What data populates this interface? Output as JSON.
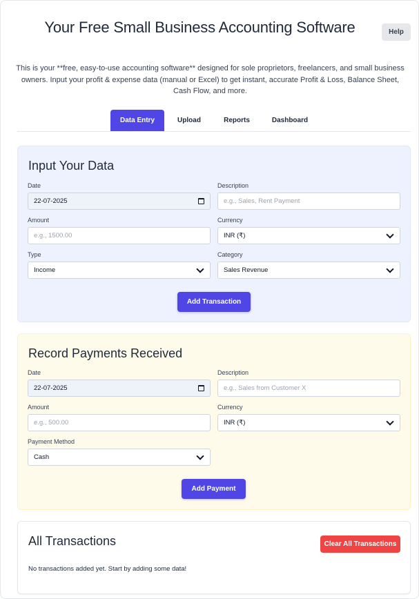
{
  "header": {
    "title": "Your Free Small Business Accounting Software",
    "help_label": "Help",
    "intro": "This is your **free, easy-to-use accounting software** designed for sole proprietors, freelancers, and small business owners. Input your profit & expense data (manual or Excel) to get instant, accurate Profit & Loss, Balance Sheet, Cash Flow, and more."
  },
  "tabs": [
    {
      "label": "Data Entry",
      "active": true
    },
    {
      "label": "Upload",
      "active": false
    },
    {
      "label": "Reports",
      "active": false
    },
    {
      "label": "Dashboard",
      "active": false
    }
  ],
  "input_data": {
    "title": "Input Your Data",
    "date": {
      "label": "Date",
      "value": "22-07-2025"
    },
    "description": {
      "label": "Description",
      "placeholder": "e.g., Sales, Rent Payment"
    },
    "amount": {
      "label": "Amount",
      "placeholder": "e.g., 1500.00"
    },
    "currency": {
      "label": "Currency",
      "value": "INR (₹)"
    },
    "type": {
      "label": "Type",
      "value": "Income"
    },
    "category": {
      "label": "Category",
      "value": "Sales Revenue"
    },
    "submit_label": "Add Transaction"
  },
  "payments": {
    "title": "Record Payments Received",
    "date": {
      "label": "Date",
      "value": "22-07-2025"
    },
    "description": {
      "label": "Description",
      "placeholder": "e.g., Sales from Customer X"
    },
    "amount": {
      "label": "Amount",
      "placeholder": "e.g., 500.00"
    },
    "currency": {
      "label": "Currency",
      "value": "INR (₹)"
    },
    "method": {
      "label": "Payment Method",
      "value": "Cash"
    },
    "submit_label": "Add Payment"
  },
  "transactions": {
    "title": "All Transactions",
    "clear_label": "Clear All Transactions",
    "empty_message": "No transactions added yet. Start by adding some data!"
  },
  "colors": {
    "accent": "#4f46e5",
    "danger": "#ef4444",
    "input_card_bg": "#eef2ff",
    "payment_card_bg": "#fffbeb"
  }
}
